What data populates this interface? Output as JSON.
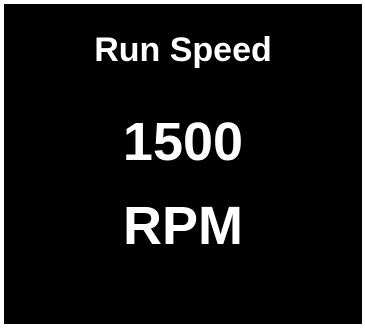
{
  "display": {
    "title": "Run Speed",
    "value": "1500",
    "unit": "RPM",
    "background_color": "#000000",
    "text_color": "#ffffff"
  }
}
